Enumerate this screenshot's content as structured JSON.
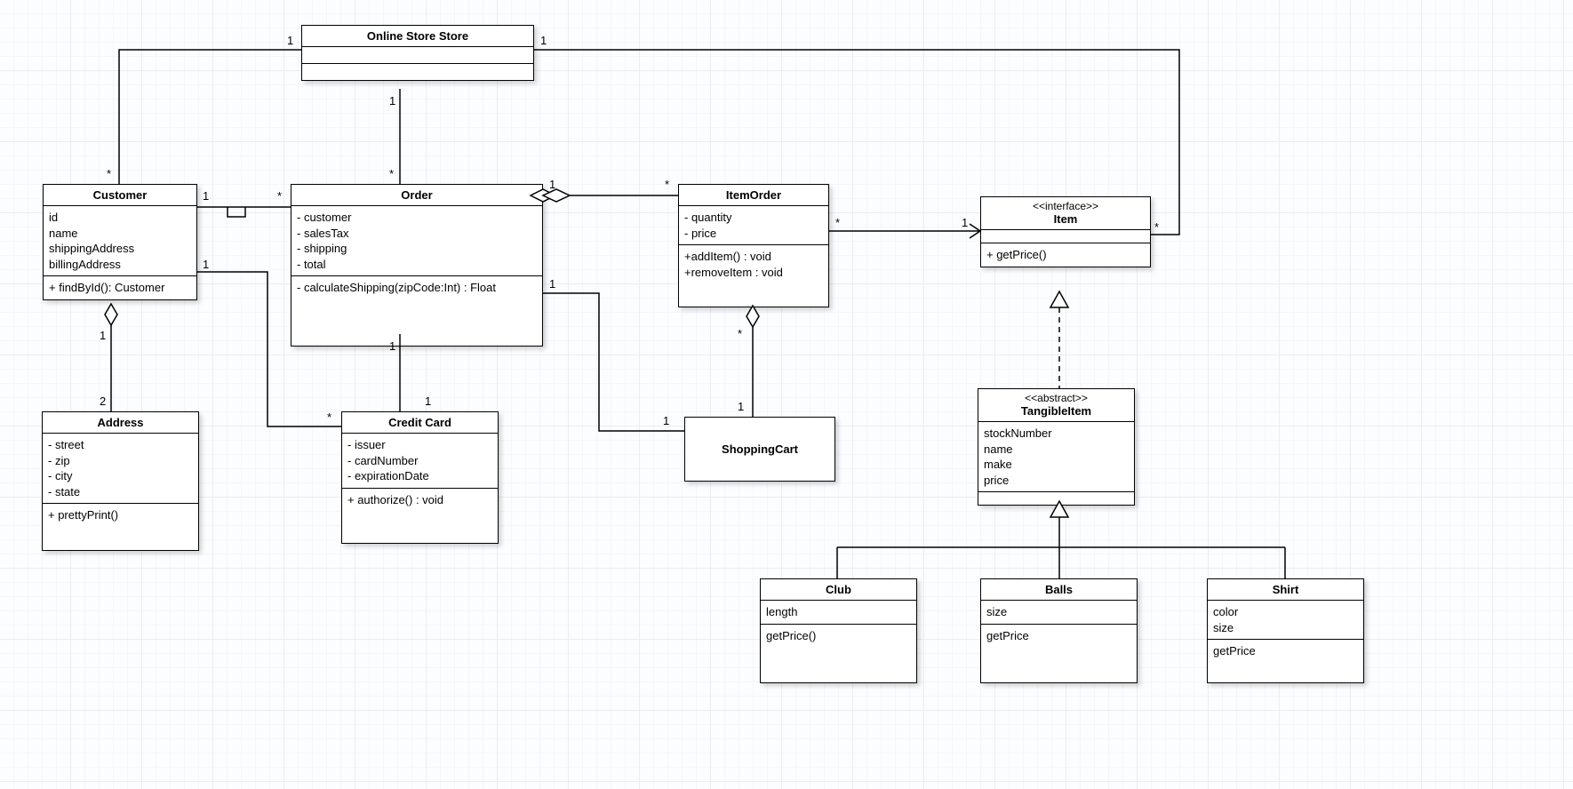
{
  "classes": {
    "store": {
      "title": "Online Store Store"
    },
    "customer": {
      "title": "Customer",
      "attrs": [
        "id",
        "name",
        "shippingAddress",
        "billingAddress"
      ],
      "ops": [
        "+ findById(): Customer"
      ]
    },
    "order": {
      "title": "Order",
      "attrs": [
        "- customer",
        "- salesTax",
        "- shipping",
        "- total"
      ],
      "ops": [
        "- calculateShipping(zipCode:Int) : Float"
      ]
    },
    "itemOrder": {
      "title": "ItemOrder",
      "attrs": [
        "- quantity",
        "- price"
      ],
      "ops": [
        "+addItem() : void",
        "+removeItem : void"
      ]
    },
    "item": {
      "stereo": "<<interface>>",
      "title": "Item",
      "ops": [
        "+ getPrice()"
      ]
    },
    "address": {
      "title": "Address",
      "attrs": [
        "- street",
        "- zip",
        "- city",
        "- state"
      ],
      "ops": [
        "+ prettyPrint()"
      ]
    },
    "credit": {
      "title": "Credit Card",
      "attrs": [
        "- issuer",
        "- cardNumber",
        "- expirationDate"
      ],
      "ops": [
        "+ authorize() : void"
      ]
    },
    "cart": {
      "title": "ShoppingCart"
    },
    "tangible": {
      "stereo": "<<abstract>>",
      "title": "TangibleItem",
      "attrs": [
        "stockNumber",
        "name",
        "make",
        "price"
      ]
    },
    "club": {
      "title": "Club",
      "attrs": [
        "length"
      ],
      "ops": [
        "getPrice()"
      ]
    },
    "balls": {
      "title": "Balls",
      "attrs": [
        "size"
      ],
      "ops": [
        "getPrice"
      ]
    },
    "shirt": {
      "title": "Shirt",
      "attrs": [
        "color",
        "size"
      ],
      "ops": [
        "getPrice"
      ]
    }
  },
  "mult": {
    "store_cust_store": "1",
    "store_cust_cust": "*",
    "store_order_store": "1",
    "store_order_order": "*",
    "store_item_store": "1",
    "store_item_item": "*",
    "cust_order_cust": "1",
    "cust_order_order": "*",
    "cust_addr_cust": "1",
    "cust_addr_addr": "2",
    "cust_cc_cust": "1",
    "cust_cc_cc": "*",
    "order_cc_order": "1",
    "order_cc_cc": "1",
    "order_item_order": "1",
    "order_item_item": "*",
    "order_cart_order": "1",
    "order_cart_cart": "1",
    "itemOrder_item_i": "*",
    "itemOrder_item_it": "1",
    "itemOrder_cart_i": "*",
    "itemOrder_cart_c": "1"
  }
}
